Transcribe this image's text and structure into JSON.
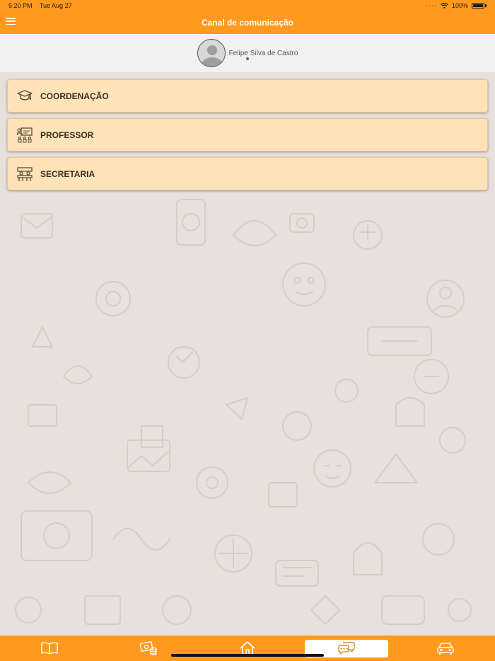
{
  "status_bar": {
    "time": "5:20 PM",
    "date": "Tue Aug 27",
    "battery": "100%",
    "icons": [
      "signal-dots-icon",
      "wifi-icon",
      "battery-icon"
    ]
  },
  "header": {
    "title": "Canal de comunicação",
    "menu_icon": "hamburger-menu-icon"
  },
  "profile": {
    "name": "Felipe Silva de Castro",
    "avatar_icon": "user-avatar-icon"
  },
  "menu": {
    "items": [
      {
        "label": "COORDENAÇÃO",
        "icon": "graduation-cap-icon"
      },
      {
        "label": "PROFESSOR",
        "icon": "teacher-board-icon"
      },
      {
        "label": "SECRETARIA",
        "icon": "secretary-desk-icon"
      }
    ]
  },
  "tabbar": {
    "tabs": [
      {
        "icon": "book-icon"
      },
      {
        "icon": "money-coins-icon"
      },
      {
        "icon": "home-icon"
      },
      {
        "icon": "chat-bubbles-icon",
        "active": true
      },
      {
        "icon": "car-icon"
      }
    ]
  },
  "colors": {
    "accent": "#ff9a1f",
    "card": "#ffe3b8",
    "background": "#e7e1db"
  }
}
